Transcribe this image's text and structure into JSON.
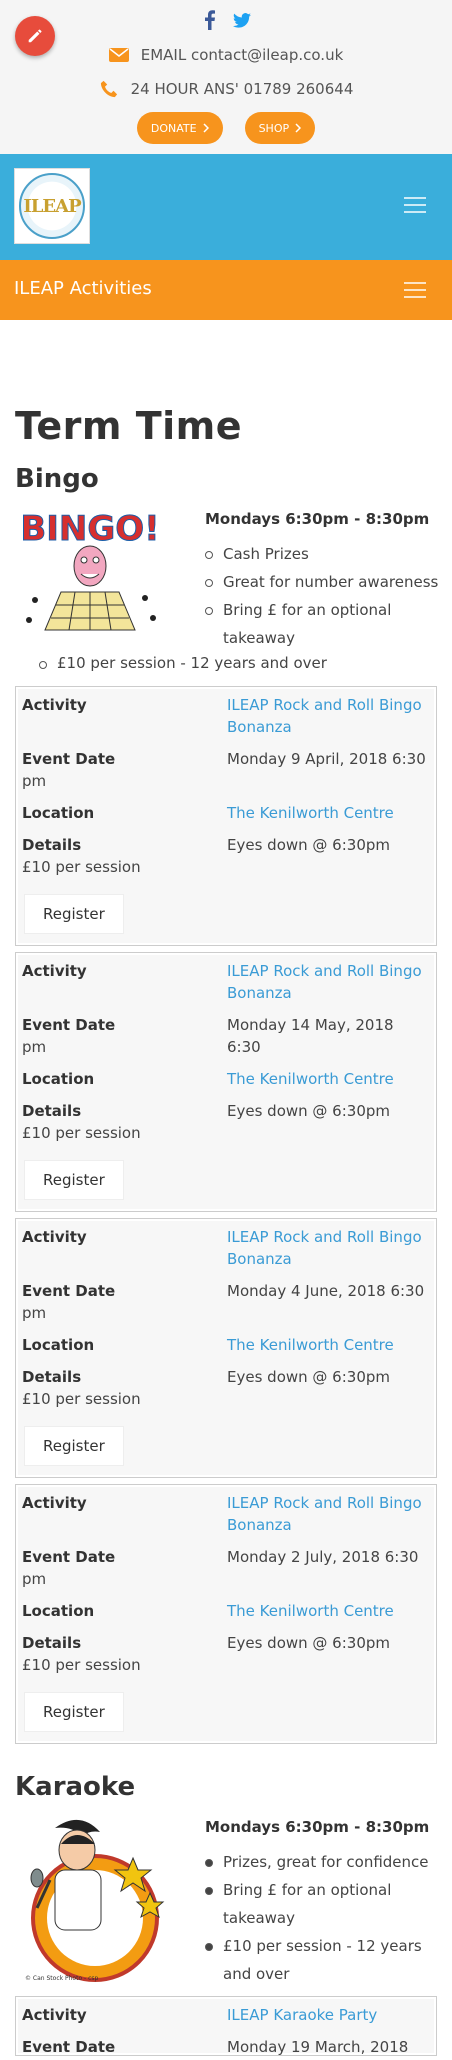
{
  "header": {
    "email_label": "EMAIL contact@ileap.co.uk",
    "phone_label": "24 HOUR ANS' 01789 260644",
    "donate_label": "DONATE",
    "shop_label": "SHOP"
  },
  "logo": {
    "text": "ILEAP"
  },
  "nav": {
    "title": "ILEAP Activities"
  },
  "page": {
    "title": "Term Time"
  },
  "bingo": {
    "title": "Bingo",
    "time": "Mondays 6:30pm - 8:30pm",
    "points": [
      "Cash Prizes",
      "Great for number awareness",
      "Bring £ for an optional takeaway"
    ],
    "extra": "£10 per session -  12 years and over"
  },
  "event_labels": {
    "activity": "Activity",
    "event_date": "Event Date",
    "location": "Location",
    "details": "Details",
    "register": "Register"
  },
  "bingo_events": [
    {
      "activity": "ILEAP Rock and Roll Bingo Bonanza",
      "date_a": "Monday 9 April, 2018 6:30",
      "date_b": "pm",
      "location": "The Kenilworth Centre",
      "details": "Eyes down @ 6:30pm",
      "price": "£10 per session"
    },
    {
      "activity": "ILEAP Rock and Roll Bingo Bonanza",
      "date_a": "Monday 14 May, 2018 6:30",
      "date_b": "pm",
      "location": "The Kenilworth Centre",
      "details": "Eyes down @ 6:30pm",
      "price": "£10 per session"
    },
    {
      "activity": "ILEAP Rock and Roll Bingo Bonanza",
      "date_a": "Monday 4 June, 2018 6:30",
      "date_b": "pm",
      "location": "The Kenilworth Centre",
      "details": "Eyes down @ 6:30pm",
      "price": "£10 per session"
    },
    {
      "activity": "ILEAP Rock and Roll Bingo Bonanza",
      "date_a": "Monday 2 July, 2018 6:30",
      "date_b": "pm",
      "location": "The Kenilworth Centre",
      "details": "Eyes down @ 6:30pm",
      "price": "£10 per session"
    }
  ],
  "karaoke": {
    "title": "Karaoke",
    "time": "Mondays 6:30pm - 8:30pm",
    "points": [
      "Prizes, great for confidence",
      "Bring £ for an optional takeaway",
      "£10 per session  - 12 years and over"
    ],
    "event": {
      "activity": "ILEAP Karaoke Party",
      "date_a": "Monday 19 March, 2018"
    }
  },
  "colors": {
    "blue": "#3aaedb",
    "orange": "#f7941d",
    "link": "#3a9bd5",
    "fab": "#e74c3c"
  },
  "icons": [
    "edit-icon",
    "facebook-icon",
    "twitter-icon",
    "envelope-icon",
    "phone-icon",
    "chevron-right-icon",
    "menu-icon"
  ]
}
